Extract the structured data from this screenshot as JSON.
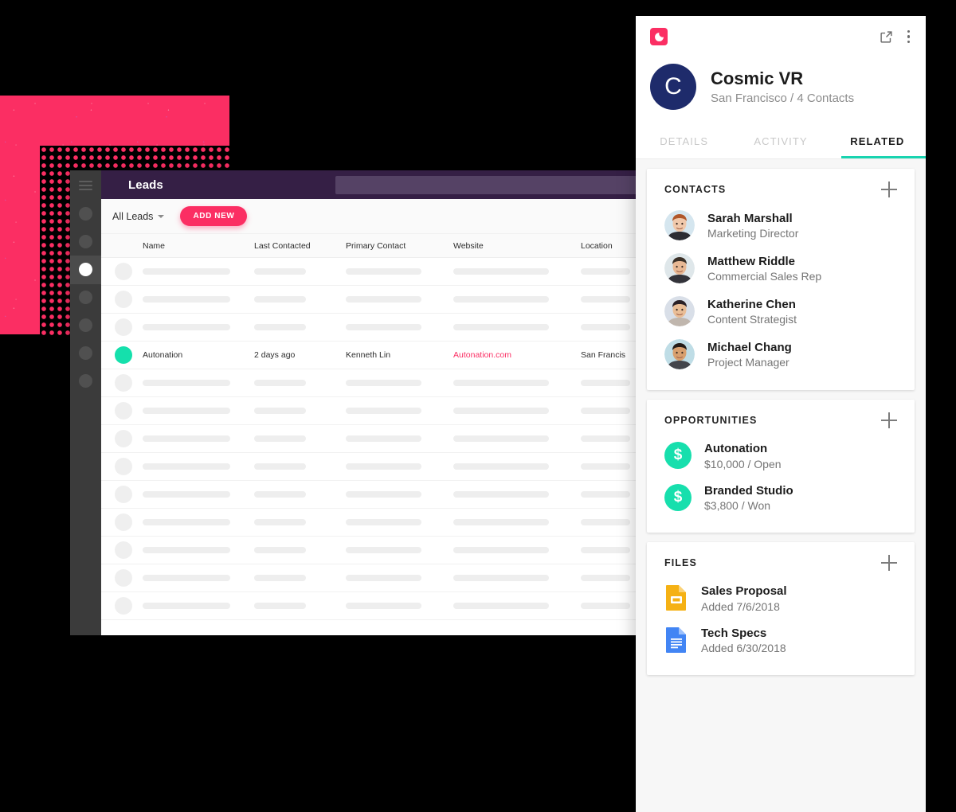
{
  "colors": {
    "brand_pink": "#fb2e63",
    "purple_header": "#351f45",
    "teal_accent": "#18d4b0",
    "avatar_navy": "#1e2b6b",
    "money_green": "#17dfad"
  },
  "leads_app": {
    "title": "Leads",
    "search_placeholder": "",
    "search_value": "",
    "hamburger_icon": "hamburger-menu-icon",
    "filter_label": "All Leads",
    "filter_caret_icon": "chevron-down-icon",
    "add_new_label": "ADD NEW",
    "columns": [
      "Name",
      "Last Contacted",
      "Primary Contact",
      "Website",
      "Location"
    ],
    "highlight_row": {
      "name": "Autonation",
      "last_contacted": "2 days ago",
      "primary_contact": "Kenneth Lin",
      "website": "Autonation.com",
      "location": "San Francis"
    },
    "skeleton_rows_above": 3,
    "skeleton_rows_below": 9,
    "nav_dots": 7,
    "nav_active_index": 2
  },
  "detail_card": {
    "brand_logo_icon": "crescent-moon-logo-icon",
    "open_external_icon": "open-in-new-icon",
    "more_menu_icon": "kebab-menu-icon",
    "avatar_letter": "C",
    "org_name": "Cosmic VR",
    "org_subtitle": "San Francisco / 4 Contacts",
    "tabs": [
      {
        "label": "DETAILS",
        "active": false
      },
      {
        "label": "ACTIVITY",
        "active": false
      },
      {
        "label": "RELATED",
        "active": true
      }
    ],
    "contacts": {
      "title": "CONTACTS",
      "add_icon": "plus-icon",
      "items": [
        {
          "name": "Sarah Marshall",
          "role": "Marketing Director",
          "avatar": "photo-avatar-woman-short-red-hair"
        },
        {
          "name": "Matthew Riddle",
          "role": "Commercial Sales Rep",
          "avatar": "photo-avatar-man-beard"
        },
        {
          "name": "Katherine Chen",
          "role": "Content Strategist",
          "avatar": "photo-avatar-woman-glasses"
        },
        {
          "name": "Michael Chang",
          "role": "Project Manager",
          "avatar": "photo-avatar-man-glasses"
        }
      ]
    },
    "opportunities": {
      "title": "OPPORTUNITIES",
      "add_icon": "plus-icon",
      "items": [
        {
          "name": "Autonation",
          "detail": "$10,000 / Open",
          "icon": "dollar-circle-icon"
        },
        {
          "name": "Branded Studio",
          "detail": "$3,800 / Won",
          "icon": "dollar-circle-icon"
        }
      ]
    },
    "files": {
      "title": "FILES",
      "add_icon": "plus-icon",
      "items": [
        {
          "name": "Sales Proposal",
          "detail": "Added 7/6/2018",
          "icon": "google-slides-file-icon"
        },
        {
          "name": "Tech Specs",
          "detail": "Added 6/30/2018",
          "icon": "google-docs-file-icon"
        }
      ]
    }
  }
}
